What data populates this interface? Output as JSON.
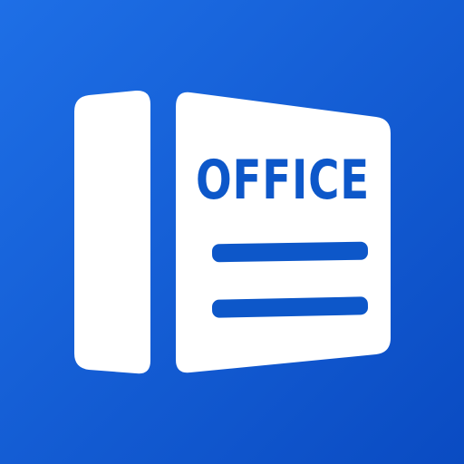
{
  "icon": {
    "name": "office-document-icon",
    "label": "OFFICE",
    "colors": {
      "background_start": "#1E6FE6",
      "background_end": "#0A4BC2",
      "foreground": "#FFFFFF",
      "accent": "#0D57C9"
    }
  }
}
